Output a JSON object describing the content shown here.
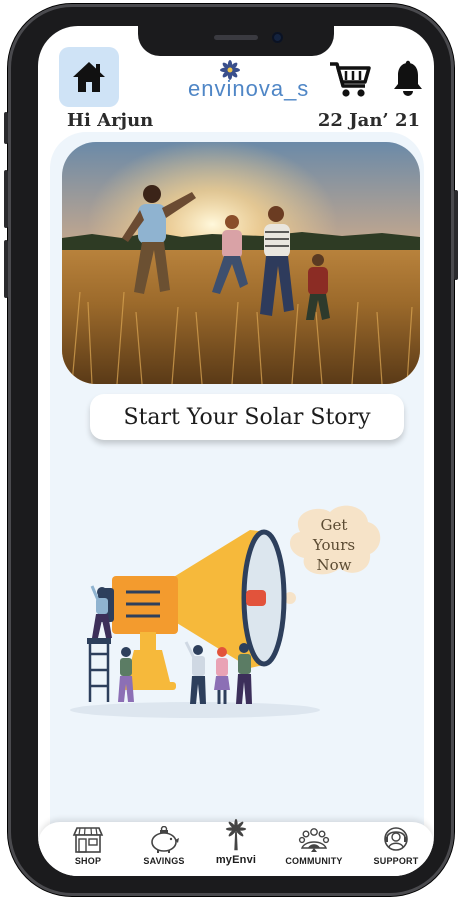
{
  "header": {
    "logo_text": "envinova_s",
    "greeting": "Hi Arjun",
    "date": "22 Jan’ 21",
    "home_icon": "home-icon",
    "cart_icon": "cart-icon",
    "bell_icon": "bell-icon"
  },
  "hero": {
    "cta_label": "Start Your Solar Story",
    "promo_line1": "Get",
    "promo_line2": "Yours",
    "promo_line3": "Now"
  },
  "tabs": [
    {
      "label": "SHOP",
      "icon": "shop-icon"
    },
    {
      "label": "SAVINGS",
      "icon": "piggy-bank-icon"
    },
    {
      "label": "myEnvi",
      "icon": "palm-tree-icon"
    },
    {
      "label": "COMMUNITY",
      "icon": "community-icon"
    },
    {
      "label": "SUPPORT",
      "icon": "support-icon"
    }
  ],
  "colors": {
    "accent_blue": "#4f86c6",
    "home_tile": "#cfe3f6",
    "content_bg": "#eef5fb",
    "megaphone": "#f6b93b"
  }
}
